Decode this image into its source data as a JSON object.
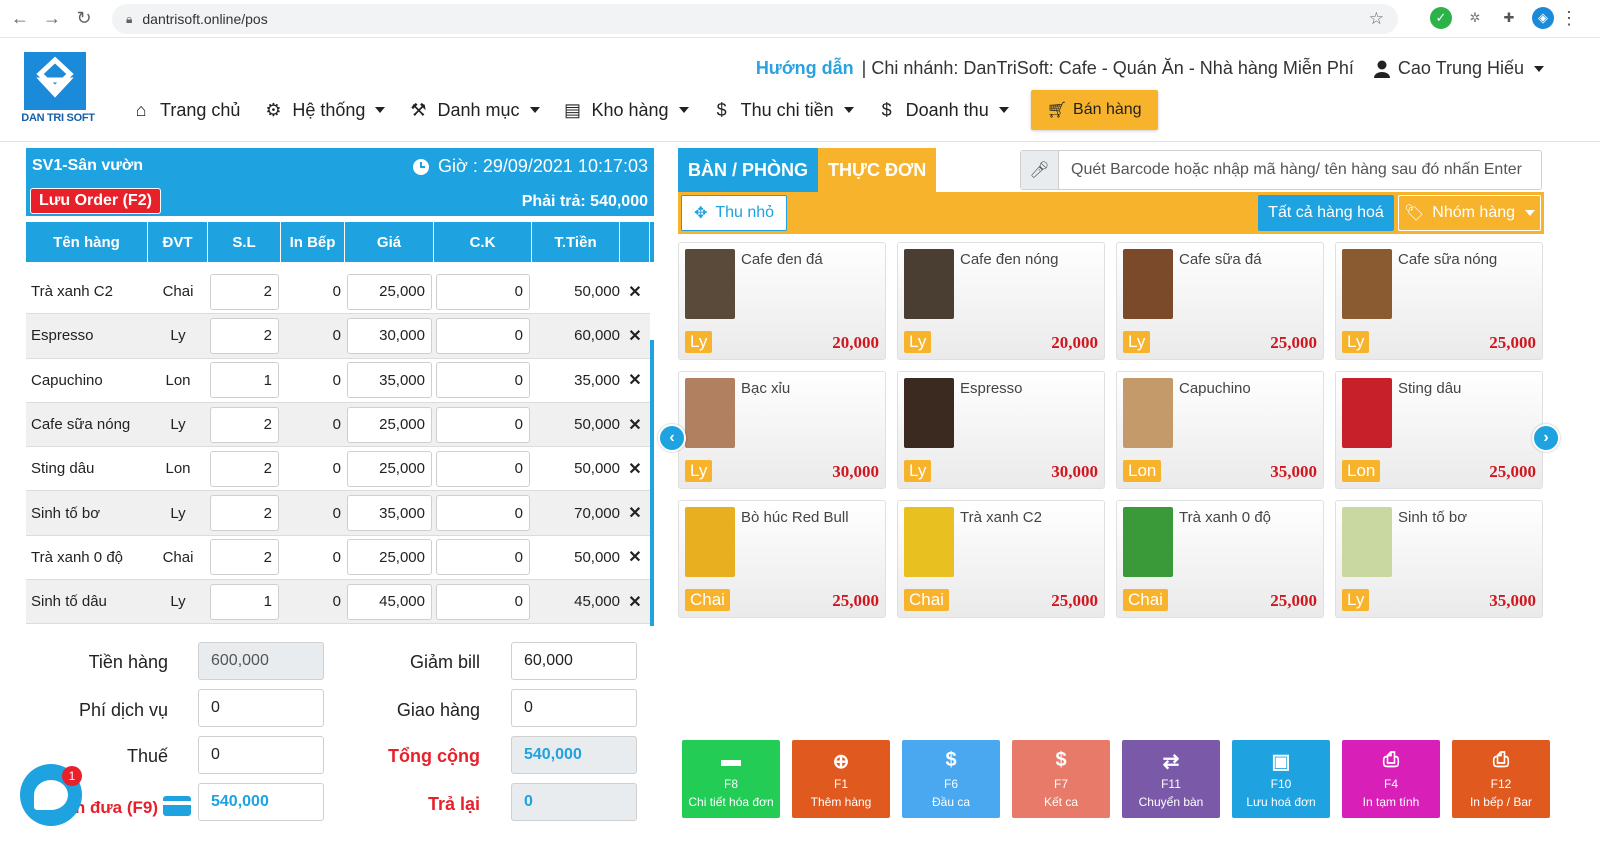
{
  "browser": {
    "url": "dantrisoft.online/pos"
  },
  "header": {
    "logo_text": "DAN TRI SOFT",
    "guide": "Hướng dẫn",
    "branch": "| Chi nhánh: DanTriSoft: Cafe - Quán Ăn - Nhà hàng Miễn Phí",
    "user": "Cao Trung Hiếu",
    "menu": [
      {
        "label": "Trang chủ",
        "icon": "home-icon"
      },
      {
        "label": "Hệ thống",
        "icon": "gear-icon"
      },
      {
        "label": "Danh mục",
        "icon": "hammer-icon"
      },
      {
        "label": "Kho hàng",
        "icon": "warehouse-icon"
      },
      {
        "label": "Thu chi tiền",
        "icon": "dollar-icon"
      },
      {
        "label": "Doanh thu",
        "icon": "dollar-icon"
      }
    ],
    "sell_button": "Bán hàng"
  },
  "order": {
    "table_name": "SV1-Sân vườn",
    "time": "Giờ : 29/09/2021 10:17:03",
    "save_order": "Lưu Order (F2)",
    "pay": "Phải trả: 540,000",
    "columns": [
      "Tên hàng",
      "ĐVT",
      "S.L",
      "In Bếp",
      "Giá",
      "C.K",
      "T.Tiền"
    ],
    "rows": [
      {
        "name": "Trà xanh C2",
        "unit": "Chai",
        "qty": "2",
        "kitchen": "0",
        "price": "25,000",
        "discount": "0",
        "total": "50,000"
      },
      {
        "name": "Espresso",
        "unit": "Ly",
        "qty": "2",
        "kitchen": "0",
        "price": "30,000",
        "discount": "0",
        "total": "60,000"
      },
      {
        "name": "Capuchino",
        "unit": "Lon",
        "qty": "1",
        "kitchen": "0",
        "price": "35,000",
        "discount": "0",
        "total": "35,000"
      },
      {
        "name": "Cafe sữa nóng",
        "unit": "Ly",
        "qty": "2",
        "kitchen": "0",
        "price": "25,000",
        "discount": "0",
        "total": "50,000"
      },
      {
        "name": "Sting dâu",
        "unit": "Lon",
        "qty": "2",
        "kitchen": "0",
        "price": "25,000",
        "discount": "0",
        "total": "50,000"
      },
      {
        "name": "Sinh tố bơ",
        "unit": "Ly",
        "qty": "2",
        "kitchen": "0",
        "price": "35,000",
        "discount": "0",
        "total": "70,000"
      },
      {
        "name": "Trà xanh 0 độ",
        "unit": "Chai",
        "qty": "2",
        "kitchen": "0",
        "price": "25,000",
        "discount": "0",
        "total": "50,000"
      },
      {
        "name": "Sinh tố dâu",
        "unit": "Ly",
        "qty": "1",
        "kitchen": "0",
        "price": "45,000",
        "discount": "0",
        "total": "45,000"
      }
    ],
    "delete_glyph": "✕"
  },
  "totals": {
    "goods_label": "Tiền hàng",
    "goods": "600,000",
    "service_label": "Phí dịch vụ",
    "service": "0",
    "tax_label": "Thuế",
    "tax": "0",
    "paid_label": "n đưa (F9)",
    "paid": "540,000",
    "discount_label": "Giảm bill",
    "discount": "60,000",
    "delivery_label": "Giao hàng",
    "delivery": "0",
    "grand_label": "Tổng cộng",
    "grand": "540,000",
    "change_label": "Trả lại",
    "change": "0"
  },
  "chat": {
    "badge": "1"
  },
  "tabs": {
    "table": "BÀN / PHÒNG",
    "menu": "THỰC ĐƠN"
  },
  "search": {
    "placeholder": "Quét Barcode hoặc nhập mã hàng/ tên hàng sau đó nhấn Enter"
  },
  "filters": {
    "shrink": "Thu nhỏ",
    "all": "Tất cả hàng hoá",
    "group": "Nhóm hàng"
  },
  "products": [
    {
      "name": "Cafe đen đá",
      "unit": "Ly",
      "price": "20,000",
      "color": "#5a4a3a"
    },
    {
      "name": "Cafe đen nóng",
      "unit": "Ly",
      "price": "20,000",
      "color": "#4a3d32"
    },
    {
      "name": "Cafe sữa đá",
      "unit": "Ly",
      "price": "25,000",
      "color": "#7a4a2a"
    },
    {
      "name": "Cafe sữa nóng",
      "unit": "Ly",
      "price": "25,000",
      "color": "#8a5a30"
    },
    {
      "name": "Bạc xỉu",
      "unit": "Ly",
      "price": "30,000",
      "color": "#b08060"
    },
    {
      "name": "Espresso",
      "unit": "Ly",
      "price": "30,000",
      "color": "#3a2a20"
    },
    {
      "name": "Capuchino",
      "unit": "Lon",
      "price": "35,000",
      "color": "#c49a6a"
    },
    {
      "name": "Sting dâu",
      "unit": "Lon",
      "price": "25,000",
      "color": "#c8202a"
    },
    {
      "name": "Bò húc Red Bull",
      "unit": "Chai",
      "price": "25,000",
      "color": "#e8b020"
    },
    {
      "name": "Trà xanh C2",
      "unit": "Chai",
      "price": "25,000",
      "color": "#e8c020"
    },
    {
      "name": "Trà xanh 0 độ",
      "unit": "Chai",
      "price": "25,000",
      "color": "#3a9a3a"
    },
    {
      "name": "Sinh tố bơ",
      "unit": "Ly",
      "price": "35,000",
      "color": "#c8d8a0"
    }
  ],
  "actions": [
    {
      "key": "F8",
      "label": "Chi tiết hóa đơn",
      "icon": "folder-icon",
      "glyph": "▬",
      "color": "#22cc55"
    },
    {
      "key": "F1",
      "label": "Thêm hàng",
      "icon": "plus-icon",
      "glyph": "⊕",
      "color": "#e05a20"
    },
    {
      "key": "F6",
      "label": "Đầu ca",
      "icon": "dollar-icon",
      "glyph": "$",
      "color": "#4aa8f0"
    },
    {
      "key": "F7",
      "label": "Kết ca",
      "icon": "dollar-icon",
      "glyph": "$",
      "color": "#e87a6a"
    },
    {
      "key": "F11",
      "label": "Chuyển bàn",
      "icon": "swap-icon",
      "glyph": "⇄",
      "color": "#7a5aa8"
    },
    {
      "key": "F10",
      "label": "Lưu hoá đơn",
      "icon": "save-icon",
      "glyph": "▣",
      "color": "#1fa2e0"
    },
    {
      "key": "F4",
      "label": "In tạm tính",
      "icon": "printer-icon",
      "glyph": "⎙",
      "color": "#d820b8"
    },
    {
      "key": "F12",
      "label": "In bếp / Bar",
      "icon": "printer-icon",
      "glyph": "⎙",
      "color": "#e05a20"
    }
  ]
}
